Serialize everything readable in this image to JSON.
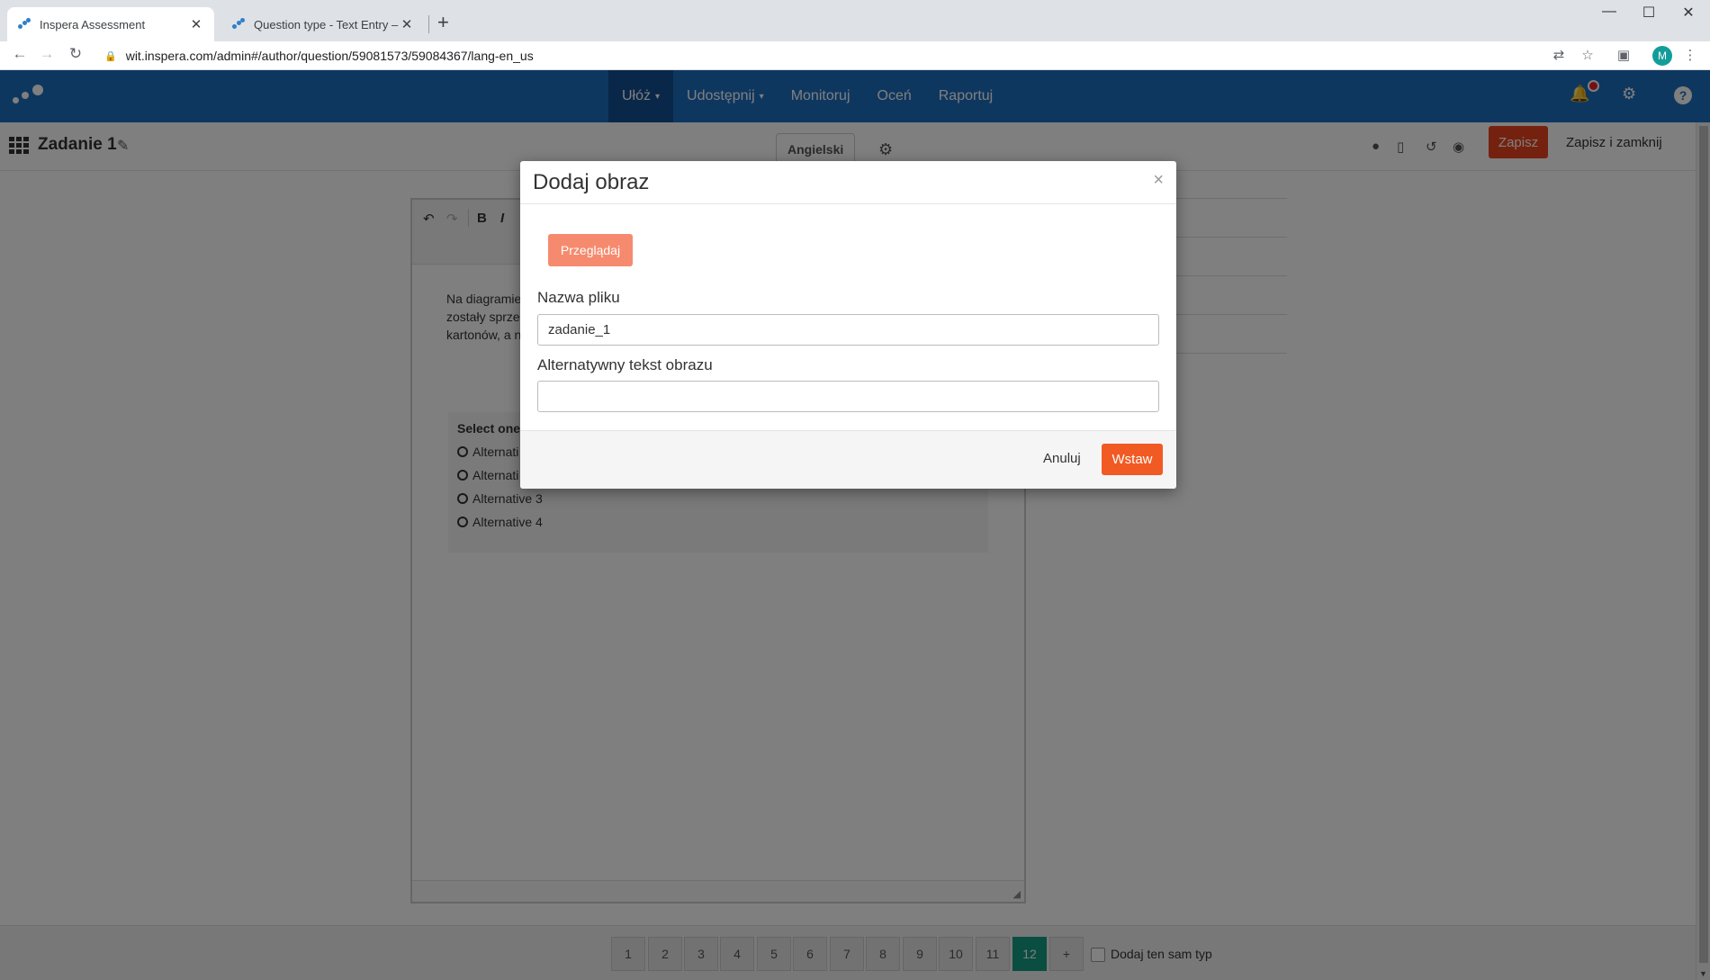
{
  "browser": {
    "tabs": [
      {
        "title": "Inspera Assessment",
        "active": true
      },
      {
        "title": "Question type - Text Entry – Insp",
        "active": false
      }
    ],
    "new_tab": "+",
    "url": "wit.inspera.com/admin#/author/question/59081573/59084367/lang-en_us",
    "profile_initial": "M",
    "window_controls": {
      "minimize": "—",
      "maximize": "☐",
      "close": "✕"
    }
  },
  "nav": {
    "items": [
      {
        "label": "Ułóż",
        "has_dropdown": true,
        "active": true
      },
      {
        "label": "Udostępnij",
        "has_dropdown": true,
        "active": false
      },
      {
        "label": "Monitoruj",
        "has_dropdown": false,
        "active": false
      },
      {
        "label": "Oceń",
        "has_dropdown": false,
        "active": false
      },
      {
        "label": "Raportuj",
        "has_dropdown": false,
        "active": false
      }
    ],
    "icons": [
      "bell-icon",
      "gear-icon",
      "help-icon"
    ],
    "colors": {
      "bar": "#1d6fc0",
      "active": "#134f93",
      "notification": "#e0252b"
    }
  },
  "subheader": {
    "title": "Zadanie 1",
    "language_tab": "Angielski",
    "save_label": "Zapisz",
    "save_close_label": "Zapisz i zamknij"
  },
  "editor": {
    "question_lines": [
      "Na diagramie",
      "zostały sprze",
      "kartonów, a n"
    ],
    "mcq_title": "Select one",
    "alternatives": [
      "Alternati",
      "Alternati",
      "Alternative 3",
      "Alternative 4"
    ]
  },
  "pager": {
    "pages": [
      "1",
      "2",
      "3",
      "4",
      "5",
      "6",
      "7",
      "8",
      "9",
      "10",
      "11",
      "12"
    ],
    "active_page": "12",
    "add_symbol": "+",
    "same_type_label": "Dodaj ten sam typ"
  },
  "modal": {
    "title": "Dodaj obraz",
    "close": "×",
    "browse_label": "Przeglądaj",
    "filename_label": "Nazwa pliku",
    "filename_value": "zadanie_1",
    "alt_label": "Alternatywny tekst obrazu",
    "alt_value": "",
    "cancel_label": "Anuluj",
    "insert_label": "Wstaw",
    "colors": {
      "browse": "#f68a6e",
      "insert": "#f15a22"
    }
  }
}
